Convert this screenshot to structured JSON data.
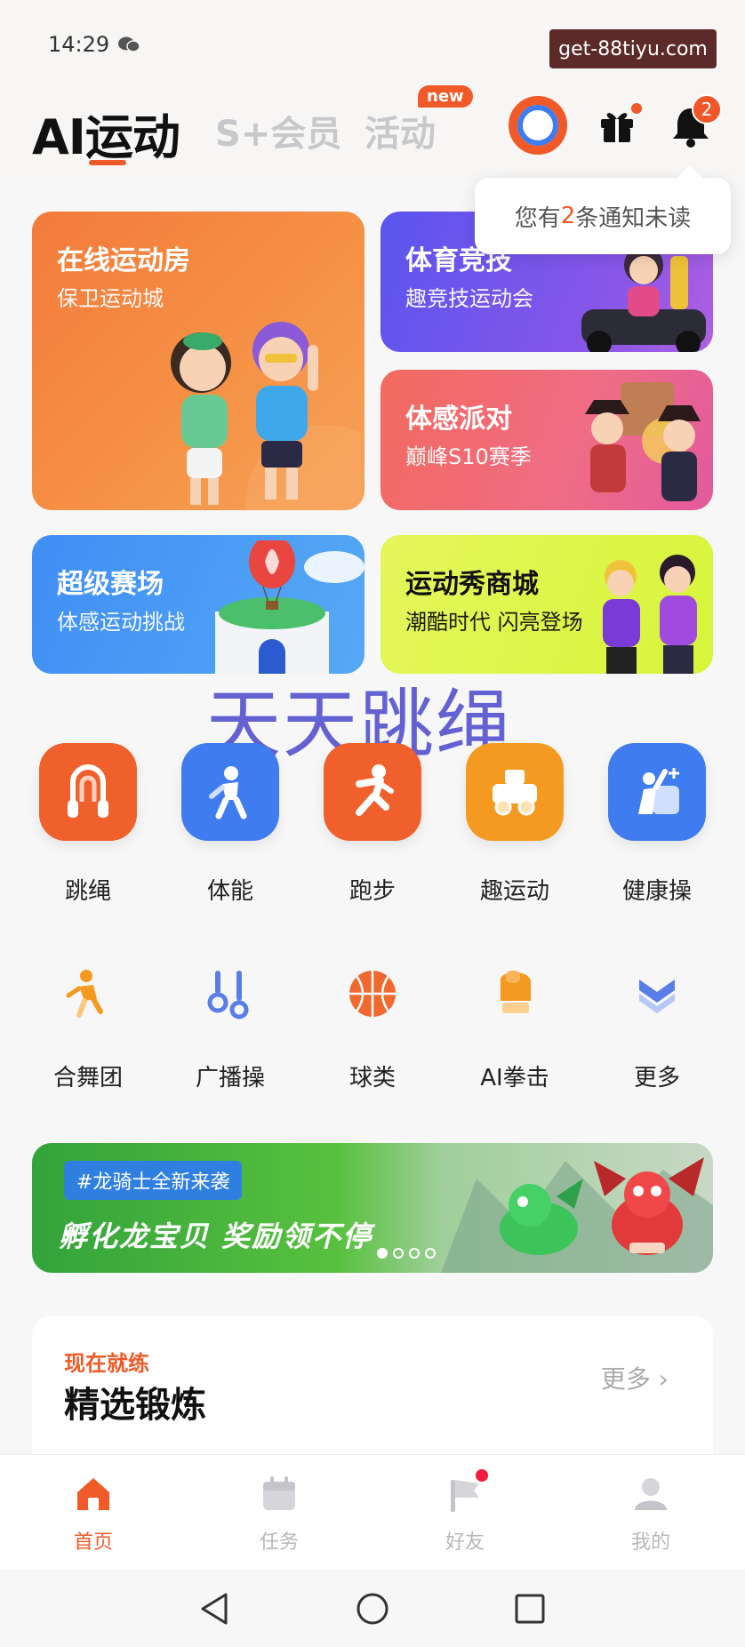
{
  "status_bar": {
    "time": "14:29",
    "watermark": "get-88tiyu.com"
  },
  "header": {
    "tabs": [
      {
        "label": "AI运动",
        "active": true
      },
      {
        "label": "S+会员",
        "active": false
      },
      {
        "label": "活动",
        "active": false,
        "badge": "new"
      }
    ],
    "notification_count": "2",
    "notification_popup": {
      "prefix": "您有",
      "count": "2",
      "suffix": "条通知未读"
    }
  },
  "cards": {
    "online": {
      "title": "在线运动房",
      "subtitle": "保卫运动城"
    },
    "compete": {
      "title": "体育竞技",
      "subtitle": "趣竞技运动会"
    },
    "party": {
      "title": "体感派对",
      "subtitle": "巅峰S10赛季"
    },
    "arena": {
      "title": "超级赛场",
      "subtitle": "体感运动挑战"
    },
    "shop": {
      "title": "运动秀商城",
      "subtitle": "潮酷时代 闪亮登场"
    }
  },
  "overlay_text": "天天跳绳",
  "main_categories": [
    {
      "label": "跳绳",
      "icon": "jump-rope-icon",
      "color": "#f0602c"
    },
    {
      "label": "体能",
      "icon": "fitness-icon",
      "color": "#3f7cf0"
    },
    {
      "label": "跑步",
      "icon": "running-icon",
      "color": "#f0602c"
    },
    {
      "label": "趣运动",
      "icon": "fun-sport-icon",
      "color": "#f59a20"
    },
    {
      "label": "健康操",
      "icon": "health-exercise-icon",
      "color": "#3f7cf0"
    }
  ],
  "sub_categories": [
    {
      "label": "合舞团",
      "icon": "dance-icon"
    },
    {
      "label": "广播操",
      "icon": "broadcast-exercise-icon"
    },
    {
      "label": "球类",
      "icon": "ball-icon"
    },
    {
      "label": "AI拳击",
      "icon": "boxing-icon"
    },
    {
      "label": "更多",
      "icon": "more-icon"
    }
  ],
  "banner": {
    "tag": "#龙骑士全新来袭",
    "text": "孵化龙宝贝  奖励领不停"
  },
  "section": {
    "kicker": "现在就练",
    "title": "精选锻炼",
    "more": "更多"
  },
  "tabbar": [
    {
      "label": "首页",
      "icon": "home-icon",
      "active": true
    },
    {
      "label": "任务",
      "icon": "calendar-icon",
      "active": false
    },
    {
      "label": "好友",
      "icon": "flag-icon",
      "active": false
    },
    {
      "label": "我的",
      "icon": "profile-icon",
      "active": false
    }
  ],
  "colors": {
    "accent": "#f05a28",
    "blue": "#3f7cf0",
    "inactive": "#c8c8cc"
  }
}
